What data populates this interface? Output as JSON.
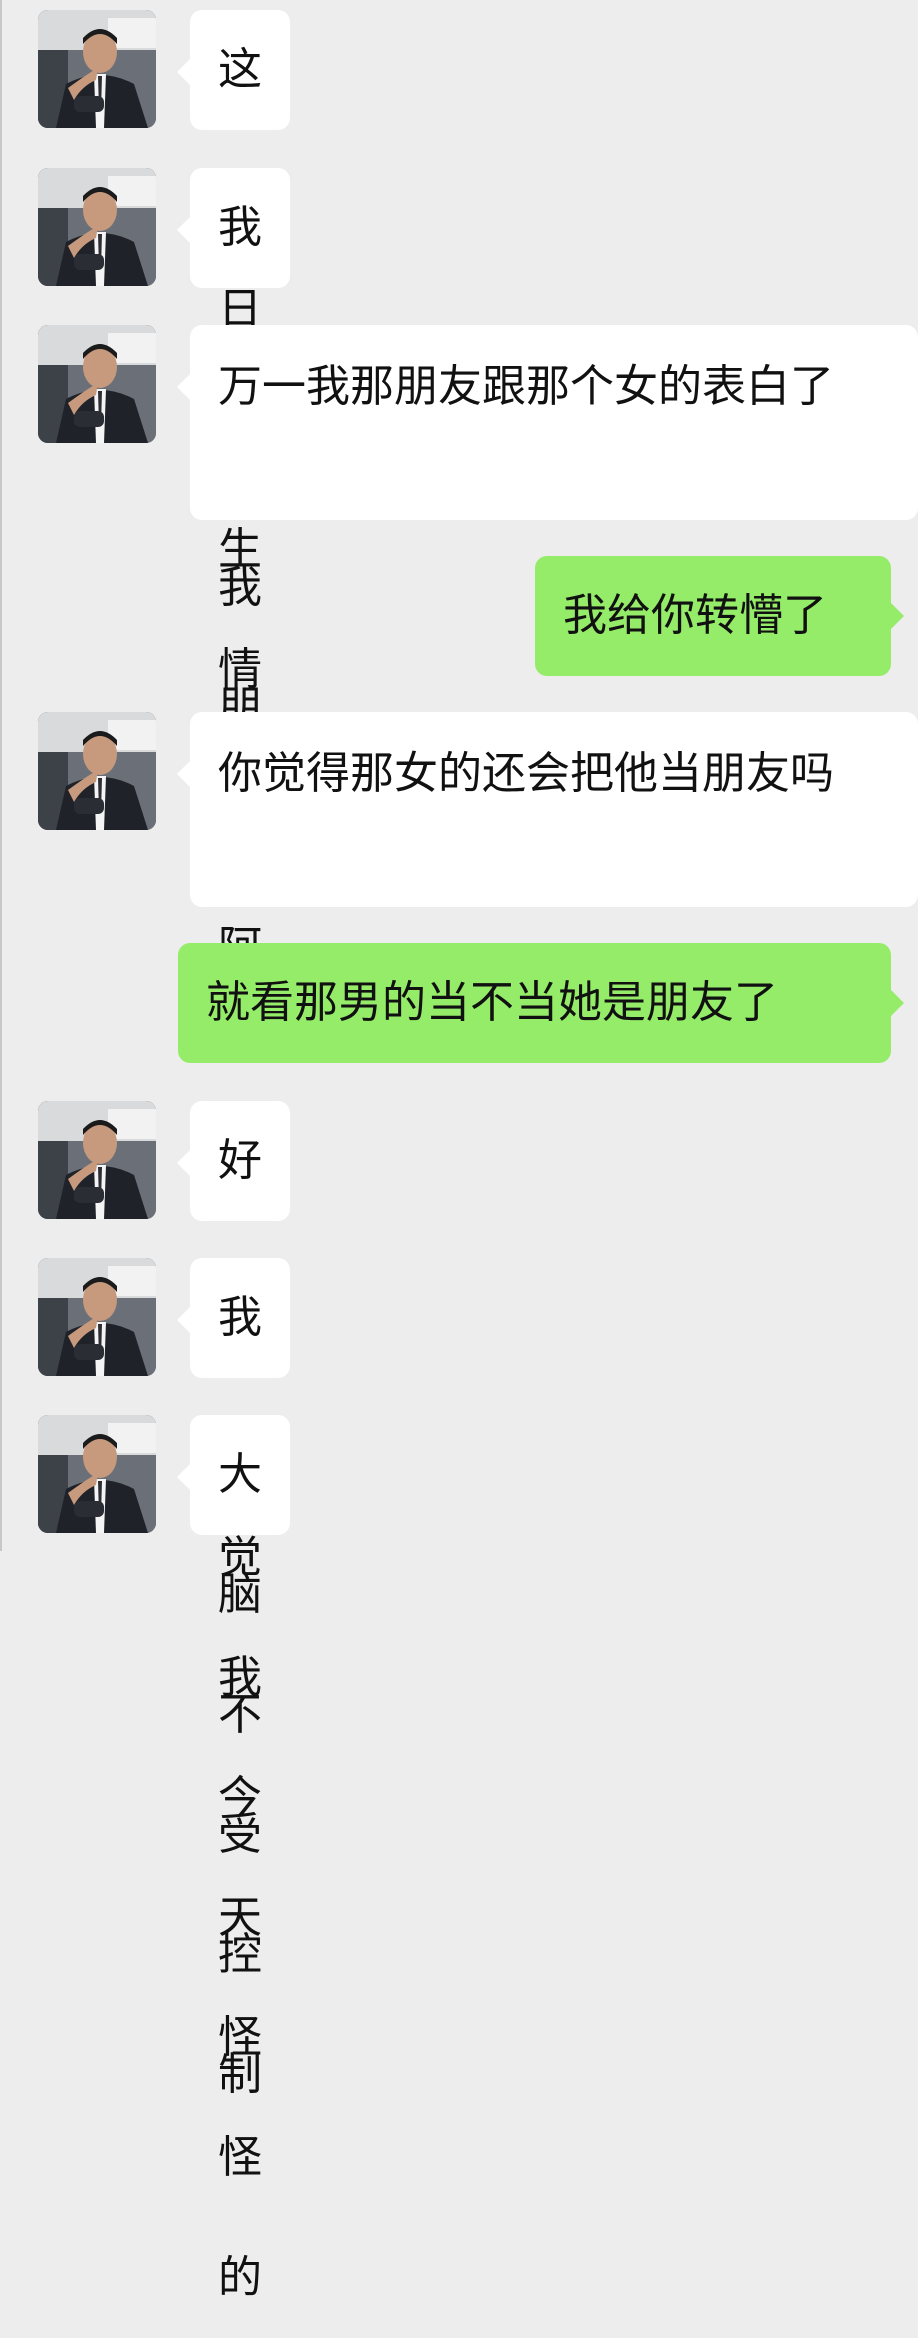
{
  "chat": {
    "messages": [
      {
        "side": "left",
        "text": "这是日久生情"
      },
      {
        "side": "left",
        "text": "我是说我朋友阿"
      },
      {
        "side": "left",
        "text": "万一我那朋友跟那个女的表白了"
      },
      {
        "side": "right",
        "text": "我给你转懵了"
      },
      {
        "side": "left",
        "text": "你觉得那女的还会把他当朋友吗"
      },
      {
        "side": "right",
        "text": "就看那男的当不当她是朋友了"
      },
      {
        "side": "left",
        "text": "好吧"
      },
      {
        "side": "left",
        "text": "我感觉我今天怪怪的"
      },
      {
        "side": "left",
        "text": "大脑不受控制"
      }
    ]
  },
  "colors": {
    "background": "#ededed",
    "incoming_bubble": "#ffffff",
    "outgoing_bubble": "#95ec69",
    "text": "#111111"
  },
  "icons": {
    "contact_avatar": "contact-avatar-photo"
  }
}
